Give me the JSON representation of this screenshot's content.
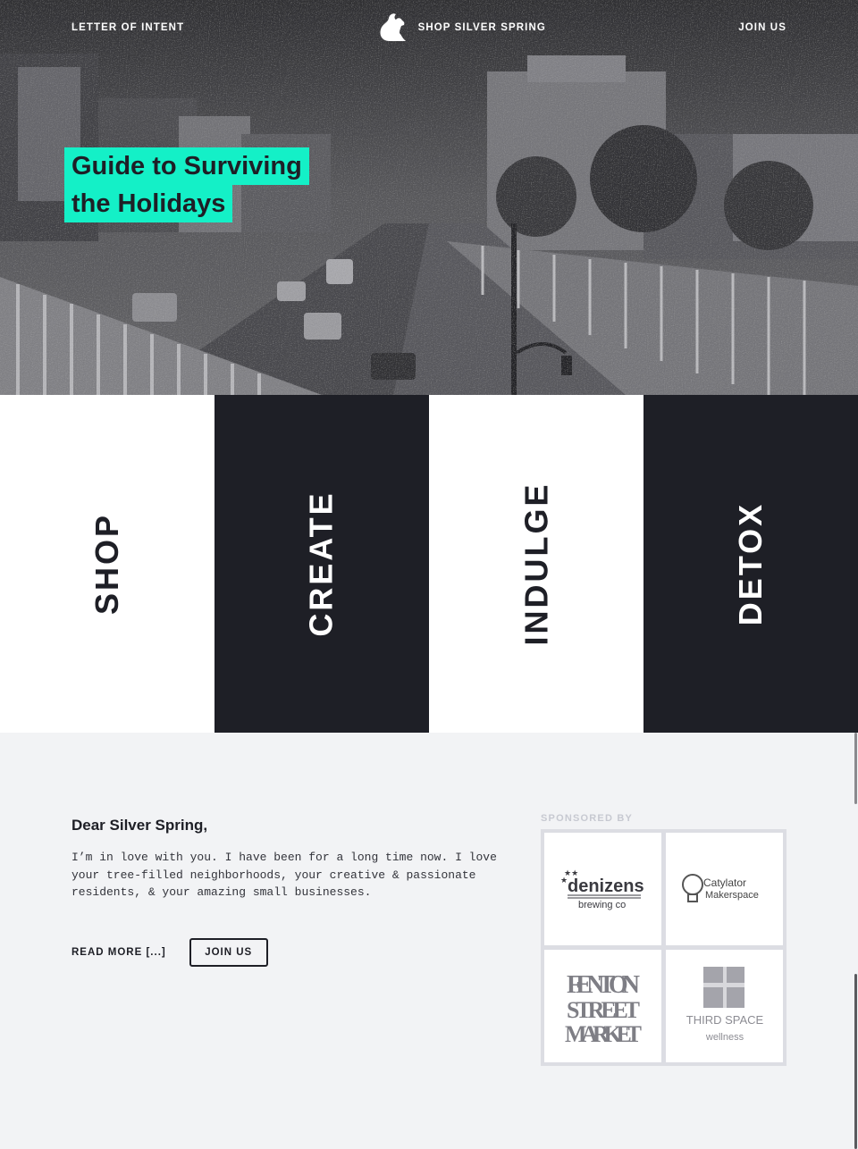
{
  "nav": {
    "left_link": "LETTER OF INTENT",
    "brand": "SHOP SILVER SPRING",
    "right_link": "JOIN US",
    "logo_icon": "squirrel-icon"
  },
  "hero": {
    "headline_line1": "Guide to Surviving",
    "headline_line2": "the Holidays",
    "accent_color": "#14f0c7"
  },
  "categories": [
    {
      "label": "SHOP",
      "theme": "light"
    },
    {
      "label": "CREATE",
      "theme": "dark"
    },
    {
      "label": "INDULGE",
      "theme": "light"
    },
    {
      "label": "DETOX",
      "theme": "dark"
    }
  ],
  "letter": {
    "greeting": "Dear Silver Spring,",
    "body": "I’m in love with you. I have been for a long time now. I love your tree-filled neighborhoods, your creative & passionate residents, & your amazing small businesses.",
    "read_more": "READ MORE [...]",
    "join_button": "JOIN US"
  },
  "sponsors": {
    "title": "SPONSORED BY",
    "items": [
      {
        "name": "denizens",
        "sub": "brewing co"
      },
      {
        "name": "Catylator",
        "sub": "Makerspace"
      },
      {
        "name": "FENTON",
        "sub": "STREET",
        "sub2": "MARKET"
      },
      {
        "name": "THIRD SPACE",
        "sub": "wellness"
      }
    ]
  },
  "colors": {
    "dark": "#1e1f26",
    "light": "#ffffff",
    "page_bg": "#f2f3f5"
  }
}
